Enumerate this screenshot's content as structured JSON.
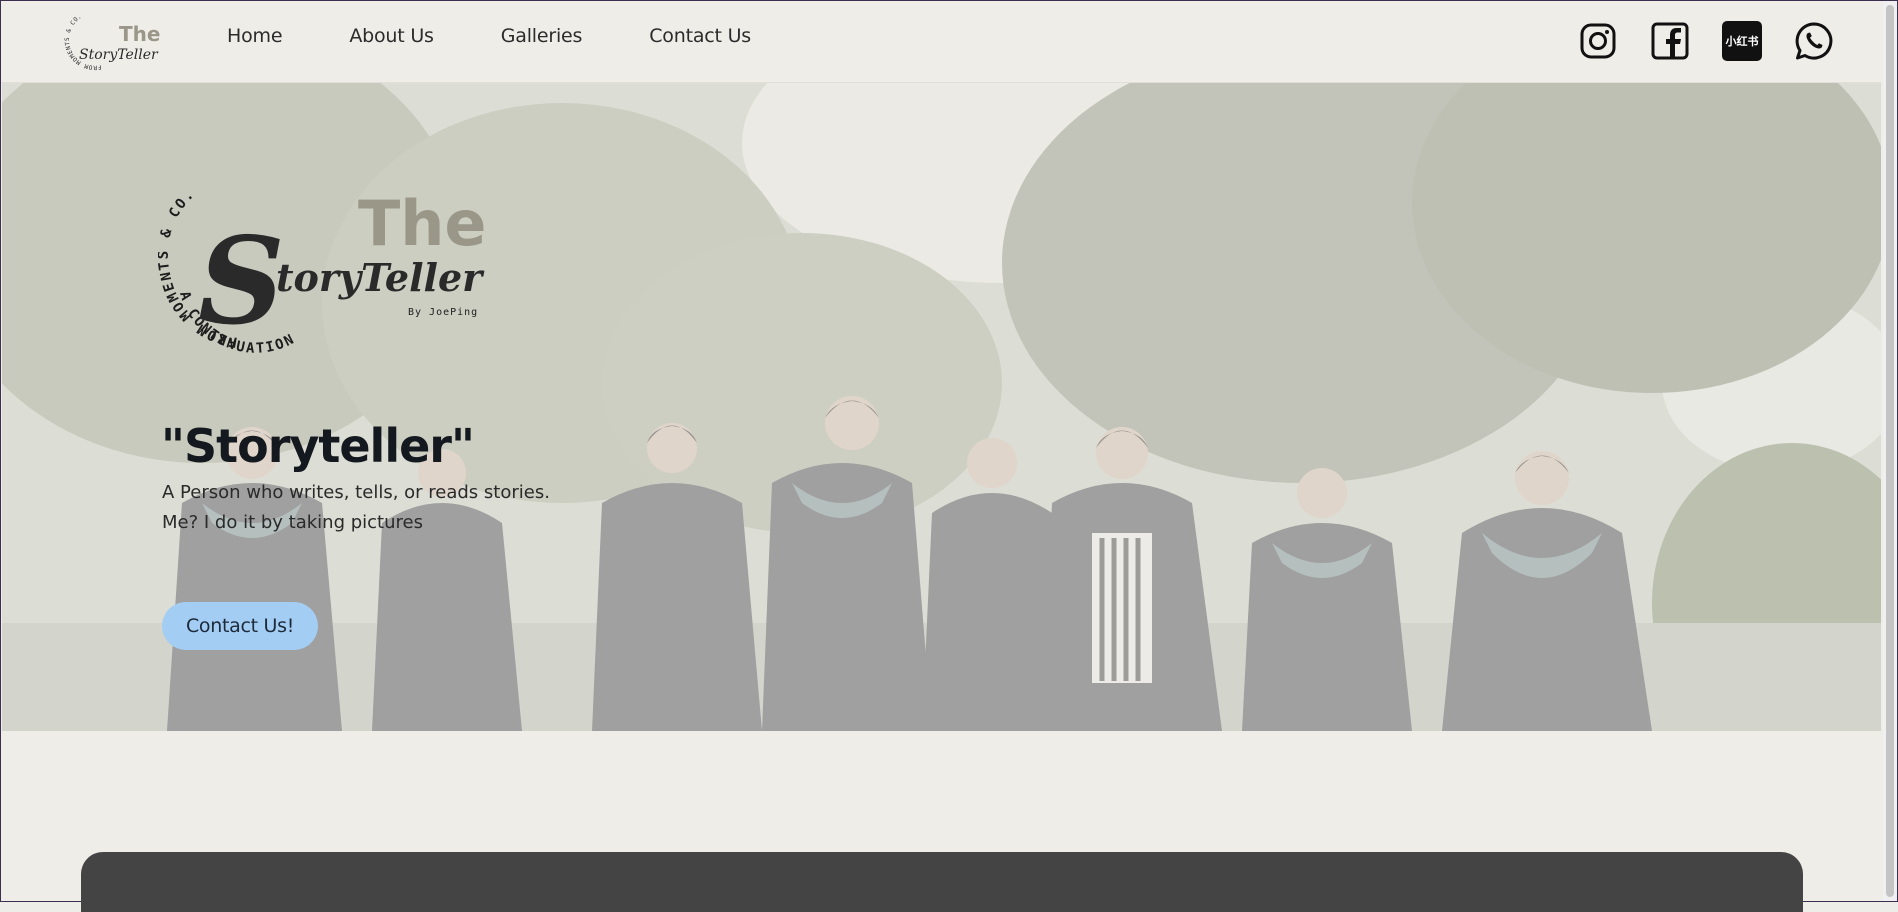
{
  "brand": {
    "small_the": "The",
    "small_story": "StoryTeller",
    "ring_top": "FROM MOMENTS & CO.",
    "ring_bottom": "A CONTINUATION",
    "big_the": "The",
    "big_story": "toryTeller",
    "big_s": "S",
    "byline": "By JoePing"
  },
  "nav": {
    "home": "Home",
    "about": "About Us",
    "galleries": "Galleries",
    "contact": "Contact Us"
  },
  "socials": {
    "instagram": "instagram-icon",
    "facebook": "facebook-icon",
    "xiaohongshu": "小红书",
    "whatsapp": "whatsapp-icon"
  },
  "hero": {
    "title": "\"Storyteller\"",
    "line1": "A Person who writes, tells, or reads stories.",
    "line2": "Me? I do it by taking pictures",
    "cta": "Contact Us!"
  },
  "colors": {
    "background": "#efede8",
    "cta": "#a4cdf4",
    "brand_khaki": "#9a9788",
    "dark_card": "#444444"
  }
}
